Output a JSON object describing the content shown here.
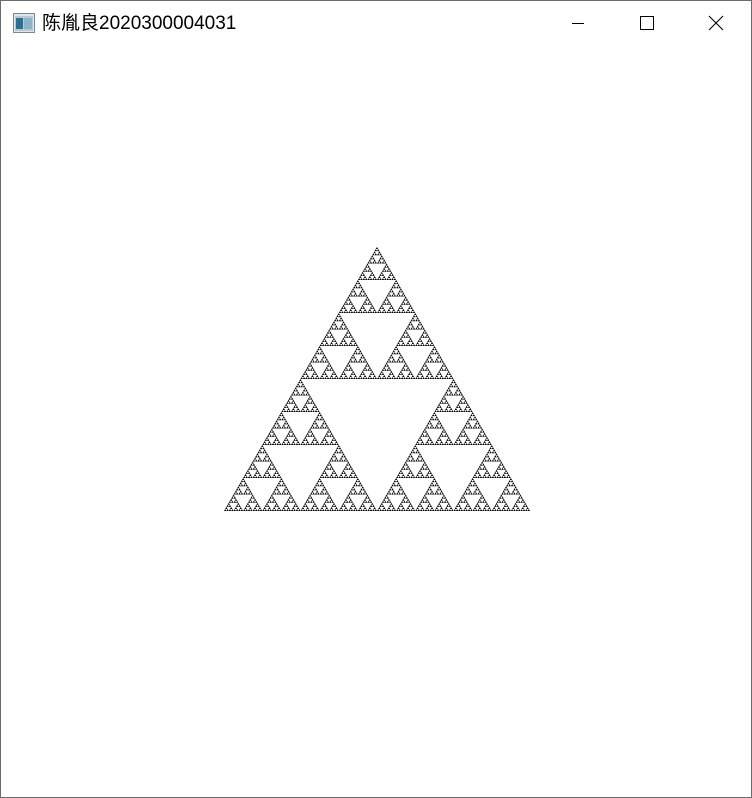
{
  "window": {
    "title": "陈胤良2020300004031"
  },
  "titlebar": {
    "app_icon": "window-app-icon",
    "buttons": [
      {
        "name": "minimize",
        "icon": "minimize-icon"
      },
      {
        "name": "maximize",
        "icon": "maximize-icon"
      },
      {
        "name": "close",
        "icon": "close-icon"
      }
    ]
  },
  "canvas": {
    "figure": "sierpinski-triangle",
    "fill_color": "#000000",
    "background_color": "#ffffff",
    "recursion_depth": 7
  }
}
